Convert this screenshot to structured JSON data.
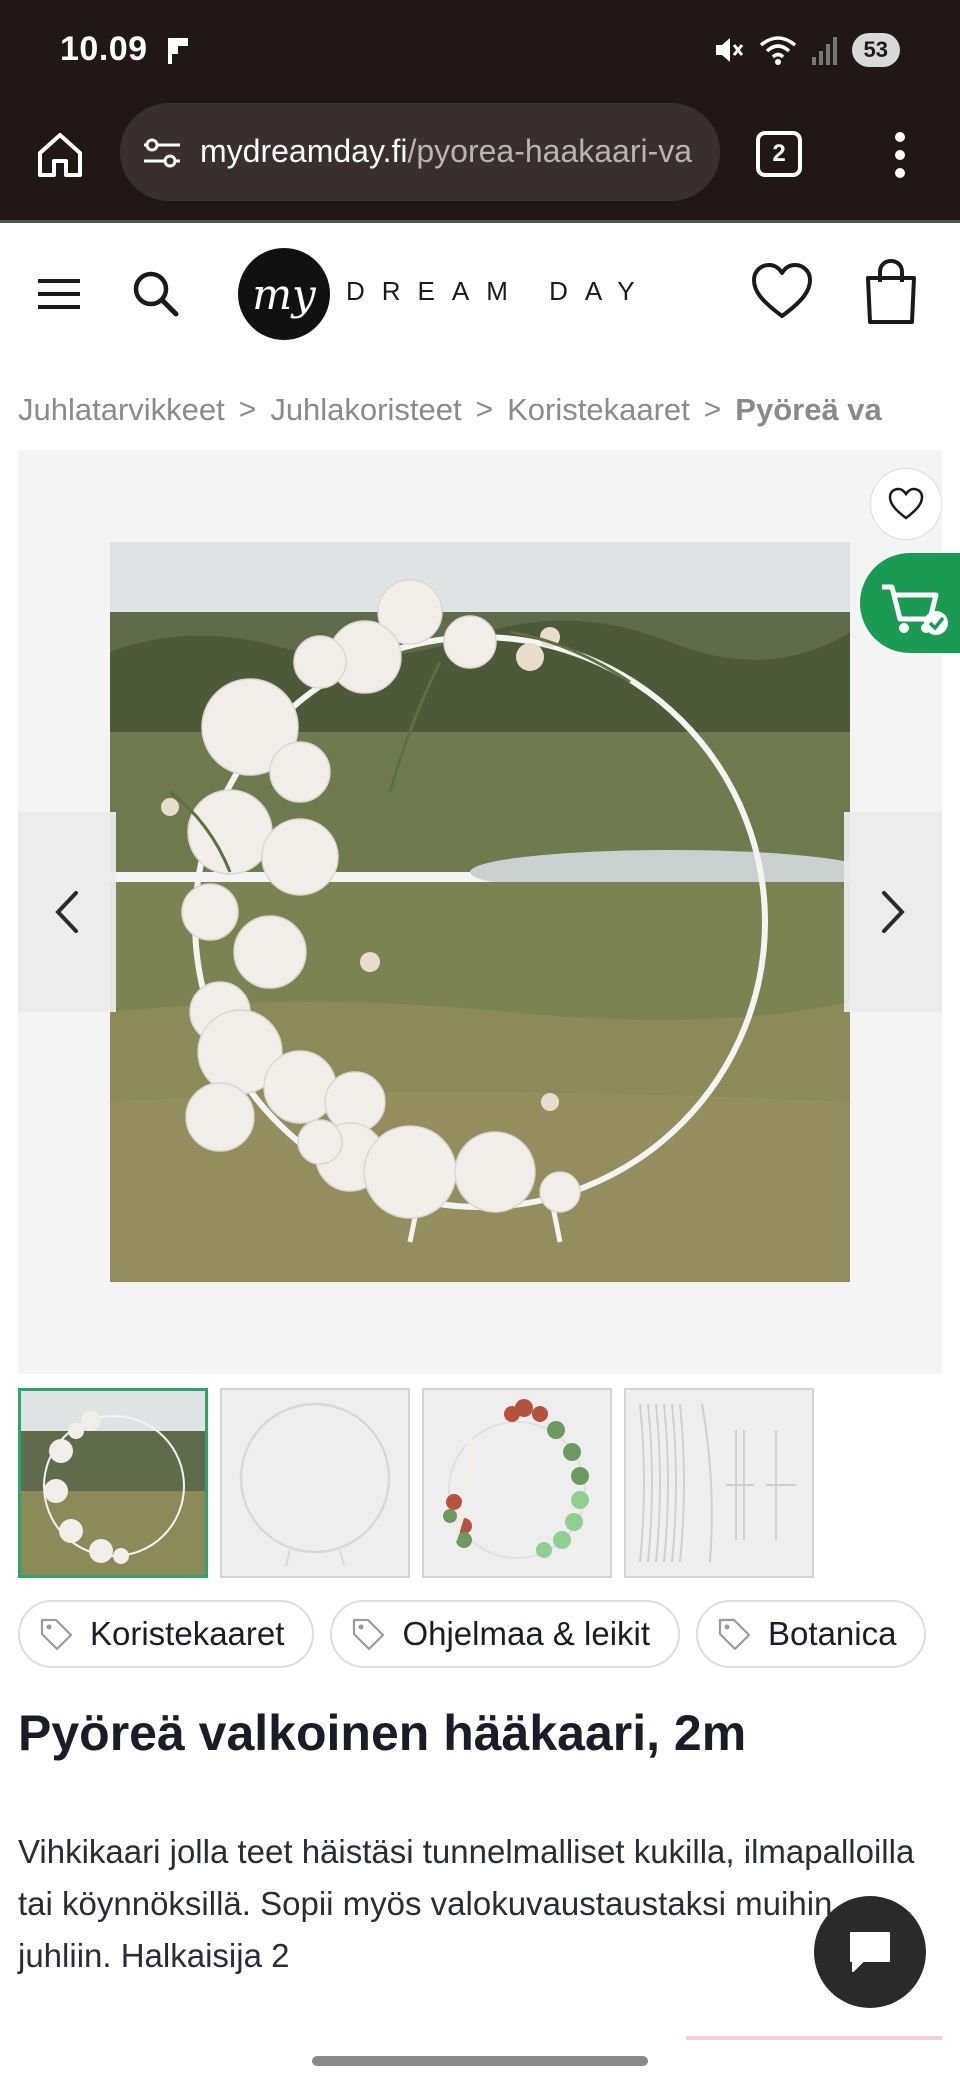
{
  "status_bar": {
    "time": "10.09",
    "battery": "53",
    "app_icon": "flipboard-icon",
    "icons": [
      "mute-icon",
      "wifi-icon",
      "signal-icon",
      "battery-icon"
    ]
  },
  "browser": {
    "domain": "mydreamday.fi",
    "path": "/pyorea-haakaari-va",
    "tab_count": "2",
    "icons": [
      "home-icon",
      "tune-icon",
      "tabs-icon",
      "more-icon"
    ]
  },
  "header": {
    "logo_mark": "my",
    "logo_text": "DREAM DAY",
    "icons": [
      "menu-icon",
      "search-icon",
      "heart-icon",
      "bag-icon"
    ]
  },
  "breadcrumb": {
    "items": [
      "Juhlatarvikkeet",
      "Juhlakoristeet",
      "Koristekaaret"
    ],
    "current": "Pyöreä va",
    "separator": ">"
  },
  "gallery": {
    "thumbnail_count": 4,
    "active_index": 0,
    "icons": [
      "favorite-icon",
      "cart-check-icon",
      "chevron-left-icon",
      "chevron-right-icon"
    ]
  },
  "tags": [
    {
      "label": "Koristekaaret"
    },
    {
      "label": "Ohjelmaa & leikit"
    },
    {
      "label": "Botanica"
    }
  ],
  "product": {
    "title": "Pyöreä valkoinen hääkaari, 2m",
    "description": "Vihkikaari jolla teet häistäsi tunnelmalliset kukilla, ilmapalloilla tai köynnöksillä. Sopii myös valokuvaustaustaksi muihin juhliin. Halkaisija 2"
  },
  "colors": {
    "browser_bg": "#221717",
    "accent_green": "#1a9a52",
    "text_dark": "#1c1c28"
  }
}
